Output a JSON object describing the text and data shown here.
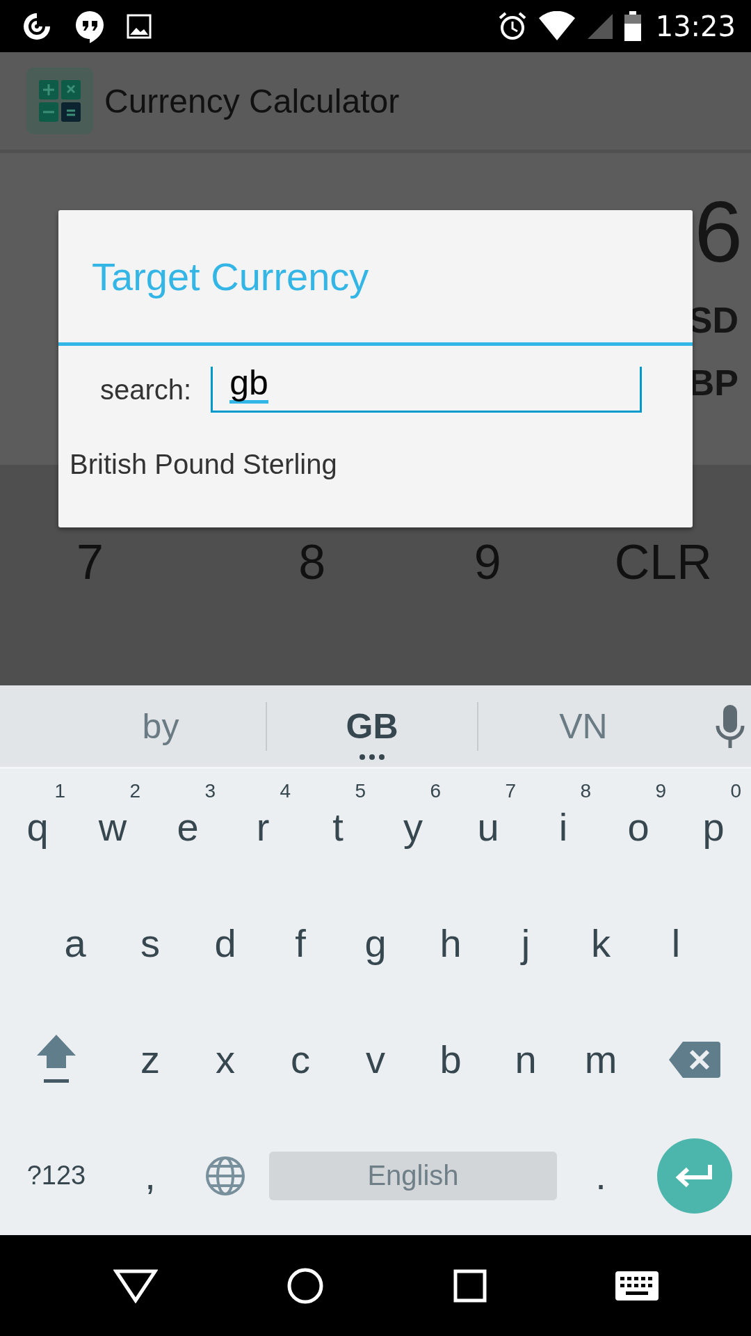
{
  "status_bar": {
    "time": "13:23"
  },
  "app_bar": {
    "title": "Currency Calculator"
  },
  "background": {
    "amount": "6",
    "from_currency": "SD",
    "to_currency": "BP",
    "keypad_row": [
      "7",
      "8",
      "9",
      "CLR"
    ]
  },
  "dialog": {
    "title": "Target Currency",
    "search": {
      "label": "search:",
      "value": "gb"
    },
    "results": [
      "British Pound Sterling"
    ]
  },
  "keyboard": {
    "suggestions": [
      {
        "text": "by",
        "selected": false
      },
      {
        "text": "GB",
        "selected": true
      },
      {
        "text": "VN",
        "selected": false
      }
    ],
    "rows": [
      {
        "keys": [
          {
            "kind": "letter",
            "label": "q",
            "hint": "1"
          },
          {
            "kind": "letter",
            "label": "w",
            "hint": "2"
          },
          {
            "kind": "letter",
            "label": "e",
            "hint": "3"
          },
          {
            "kind": "letter",
            "label": "r",
            "hint": "4"
          },
          {
            "kind": "letter",
            "label": "t",
            "hint": "5"
          },
          {
            "kind": "letter",
            "label": "y",
            "hint": "6"
          },
          {
            "kind": "letter",
            "label": "u",
            "hint": "7"
          },
          {
            "kind": "letter",
            "label": "i",
            "hint": "8"
          },
          {
            "kind": "letter",
            "label": "o",
            "hint": "9"
          },
          {
            "kind": "letter",
            "label": "p",
            "hint": "0"
          }
        ]
      },
      {
        "keys": [
          {
            "kind": "letter",
            "label": "a"
          },
          {
            "kind": "letter",
            "label": "s"
          },
          {
            "kind": "letter",
            "label": "d"
          },
          {
            "kind": "letter",
            "label": "f"
          },
          {
            "kind": "letter",
            "label": "g"
          },
          {
            "kind": "letter",
            "label": "h"
          },
          {
            "kind": "letter",
            "label": "j"
          },
          {
            "kind": "letter",
            "label": "k"
          },
          {
            "kind": "letter",
            "label": "l"
          }
        ]
      },
      {
        "keys": [
          {
            "kind": "shift"
          },
          {
            "kind": "letter",
            "label": "z"
          },
          {
            "kind": "letter",
            "label": "x"
          },
          {
            "kind": "letter",
            "label": "c"
          },
          {
            "kind": "letter",
            "label": "v"
          },
          {
            "kind": "letter",
            "label": "b"
          },
          {
            "kind": "letter",
            "label": "n"
          },
          {
            "kind": "letter",
            "label": "m"
          },
          {
            "kind": "backspace"
          }
        ]
      },
      {
        "keys": [
          {
            "kind": "symbols",
            "label": "?123"
          },
          {
            "kind": "letter",
            "label": ","
          },
          {
            "kind": "globe"
          },
          {
            "kind": "space",
            "label": "English"
          },
          {
            "kind": "letter",
            "label": "."
          },
          {
            "kind": "enter"
          }
        ]
      }
    ]
  }
}
